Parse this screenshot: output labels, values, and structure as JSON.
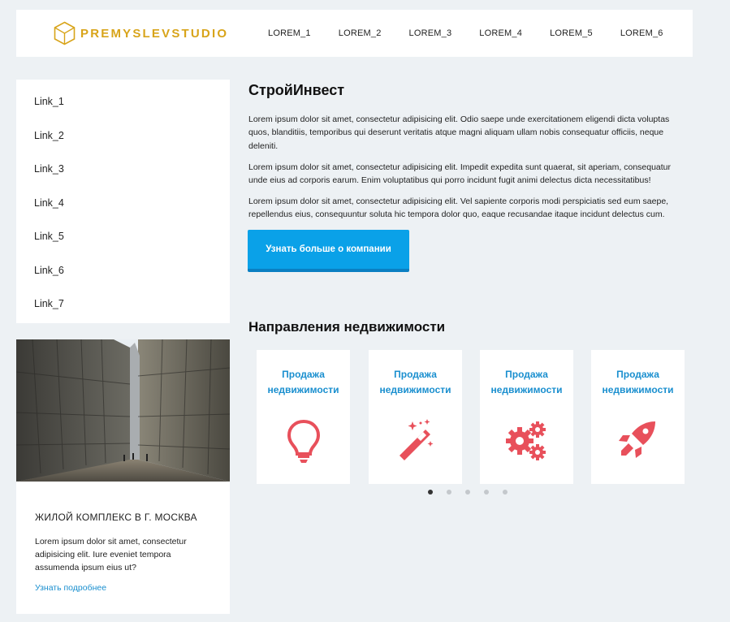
{
  "header": {
    "logo_text": "PREMYSLEVSTUDIO",
    "brand_color": "#d8a41a",
    "nav": [
      "LOREM_1",
      "LOREM_2",
      "LOREM_3",
      "LOREM_4",
      "LOREM_5",
      "LOREM_6"
    ]
  },
  "sidebar": {
    "links": [
      "Link_1",
      "Link_2",
      "Link_3",
      "Link_4",
      "Link_5",
      "Link_6",
      "Link_7"
    ]
  },
  "card": {
    "title": "ЖИЛОЙ КОМПЛЕКС В Г. МОСКВА",
    "text": "Lorem ipsum dolor sit amet, consectetur adipisicing elit. Iure eveniet tempora assumenda ipsum eius ut?",
    "link": "Узнать подробнее"
  },
  "main": {
    "title": "СтройИнвест",
    "paragraphs": [
      "Lorem ipsum dolor sit amet, consectetur adipisicing elit. Odio saepe unde exercitationem eligendi dicta voluptas quos, blanditiis, temporibus qui deserunt veritatis atque magni aliquam ullam nobis consequatur officiis, neque deleniti.",
      "Lorem ipsum dolor sit amet, consectetur adipisicing elit. Impedit expedita sunt quaerat, sit aperiam, consequatur unde eius ad corporis earum. Enim voluptatibus qui porro incidunt fugit animi delectus dicta necessitatibus!",
      "Lorem ipsum dolor sit amet, consectetur adipisicing elit. Vel sapiente corporis modi perspiciatis sed eum saepe, repellendus eius, consequuntur soluta hic tempora dolor quo, eaque recusandae itaque incidunt delectus cum."
    ],
    "cta": "Узнать больше о компании"
  },
  "directions": {
    "title": "Направления недвижимости",
    "accent_color": "#1a8fcf",
    "icon_color": "#e8505b",
    "items": [
      {
        "label": "Продажа недвижимости",
        "icon": "lightbulb-icon"
      },
      {
        "label": "Продажа недвижимости",
        "icon": "magic-wand-icon"
      },
      {
        "label": "Продажа недвижимости",
        "icon": "gears-icon"
      },
      {
        "label": "Продажа недвижимости",
        "icon": "rocket-icon"
      }
    ],
    "pagination": {
      "pages": 5,
      "active": 1
    }
  }
}
